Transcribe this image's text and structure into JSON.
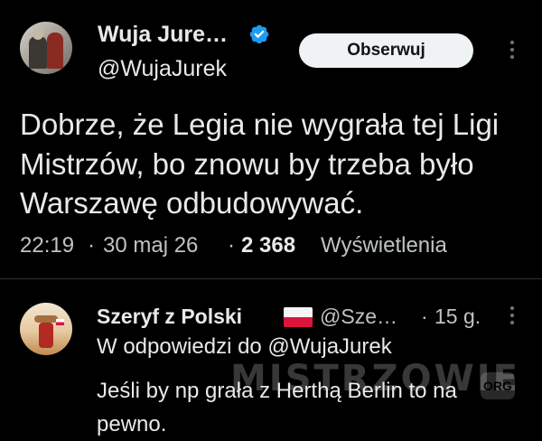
{
  "tweet": {
    "author_name": "Wuja Jure…",
    "author_handle": "@WujaJurek",
    "follow_label": "Obserwuj",
    "text": "Dobrze, że Legia nie wygrała tej Ligi Mistrzów, bo znowu by trzeba było Warszawę odbudowywać.",
    "time": "22:19",
    "date": "30 maj 26",
    "separator": "·",
    "views_count": "2 368",
    "views_label": "Wyświetlenia",
    "verified_icon": "verified-badge-icon",
    "more_icon": "more-vertical-icon"
  },
  "reply": {
    "author_name": "Szeryf z Polski",
    "flag_icon": "poland-flag-icon",
    "author_handle": "@Sze…",
    "separator": "·",
    "time_ago": "15 g.",
    "reply_to": "W odpowiedzi do @WujaJurek",
    "text": "Jeśli by np grała z Herthą Berlin to na pewno."
  },
  "watermark": {
    "text": "MISTRZOWIE",
    "badge": "ORG"
  },
  "colors": {
    "background": "#000000",
    "text_primary": "#e7e9ea",
    "text_secondary": "#bfc3c6",
    "verified_blue": "#1d9bf0",
    "follow_button_bg": "#eff3f4",
    "divider": "#2f3336"
  }
}
